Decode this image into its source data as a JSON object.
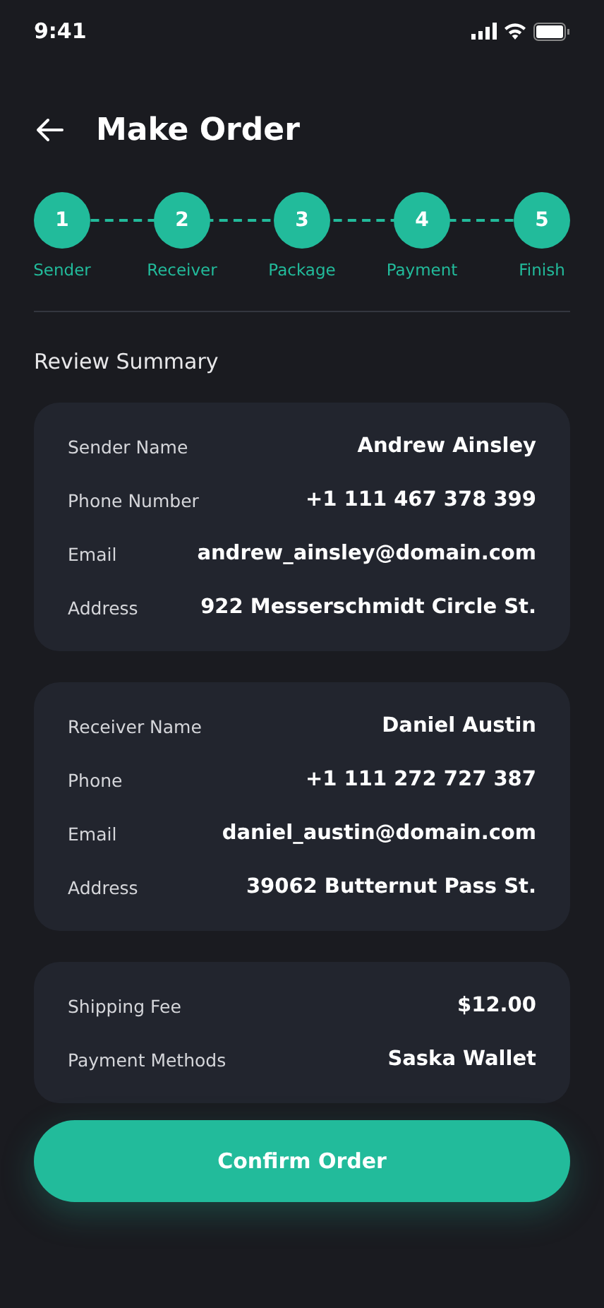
{
  "status_bar": {
    "time": "9:41"
  },
  "header": {
    "title": "Make Order"
  },
  "steps": [
    {
      "number": "1",
      "label": "Sender"
    },
    {
      "number": "2",
      "label": "Receiver"
    },
    {
      "number": "3",
      "label": "Package"
    },
    {
      "number": "4",
      "label": "Payment"
    },
    {
      "number": "5",
      "label": "Finish"
    }
  ],
  "section_title": "Review Summary",
  "cards": [
    {
      "rows": [
        {
          "label": "Sender Name",
          "value": "Andrew Ainsley"
        },
        {
          "label": "Phone Number",
          "value": "+1 111 467 378 399"
        },
        {
          "label": "Email",
          "value": "andrew_ainsley@domain.com"
        },
        {
          "label": "Address",
          "value": "922 Messerschmidt Circle St."
        }
      ]
    },
    {
      "rows": [
        {
          "label": "Receiver Name",
          "value": "Daniel Austin"
        },
        {
          "label": "Phone",
          "value": "+1 111 272 727 387"
        },
        {
          "label": "Email",
          "value": "daniel_austin@domain.com"
        },
        {
          "label": "Address",
          "value": "39062 Butternut Pass St."
        }
      ]
    },
    {
      "rows": [
        {
          "label": "Shipping Fee",
          "value": "$12.00"
        },
        {
          "label": "Payment Methods",
          "value": "Saska Wallet"
        }
      ]
    }
  ],
  "confirm_button": "Confirm Order"
}
